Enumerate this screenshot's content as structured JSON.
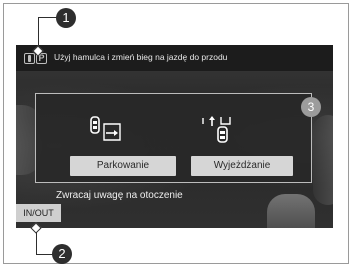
{
  "top_message": "Użyj hamulca i zmień bieg na jazdę do przodu",
  "gear_indicator": {
    "letter": "P",
    "icon": "parking-sensor-icon"
  },
  "panel": {
    "modes": [
      {
        "icon": "parallel-parking-icon",
        "label": "Parkowanie"
      },
      {
        "icon": "exit-parking-icon",
        "label": "Wyjeżdżanie"
      }
    ]
  },
  "warning_text": "Zwracaj uwagę na otoczenie",
  "inout_label": "IN/OUT",
  "callouts": [
    "1",
    "2",
    "3"
  ],
  "colors": {
    "screen_bg": "#2b2b2b",
    "button_bg": "#d6d6d6",
    "callout_dark": "#2e2e2e",
    "callout_grey": "#9c9c9c",
    "frame": "#9a9a9a"
  }
}
